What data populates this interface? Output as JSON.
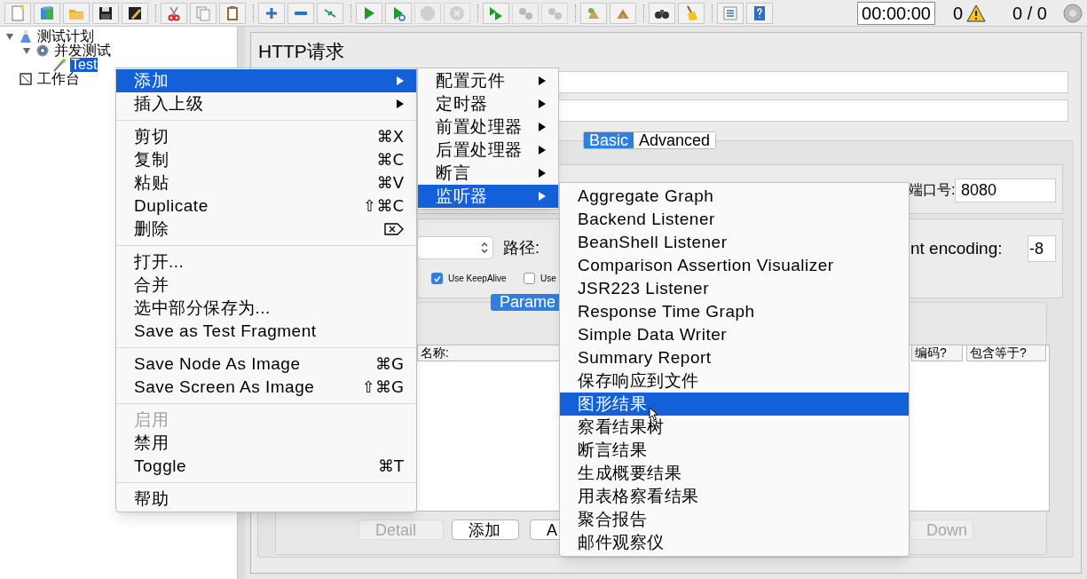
{
  "toolbar": {
    "buttons": [
      {
        "disabled": false
      },
      {
        "disabled": false
      },
      {
        "disabled": false
      },
      {
        "disabled": false
      },
      {
        "disabled": false
      },
      {
        "disabled": false
      },
      {
        "disabled": false
      },
      {
        "disabled": false
      },
      {
        "disabled": false
      },
      {
        "disabled": false
      },
      {
        "disabled": false
      },
      {
        "disabled": false
      },
      {
        "disabled": false
      },
      {
        "disabled": true
      },
      {
        "disabled": true
      },
      {
        "disabled": false
      },
      {
        "disabled": true
      },
      {
        "disabled": true
      },
      {
        "disabled": false
      },
      {
        "disabled": false
      },
      {
        "disabled": false
      },
      {
        "disabled": false
      },
      {
        "disabled": false
      },
      {
        "disabled": false
      }
    ],
    "timer": "00:00:00",
    "warning_count": "0",
    "threads": "0 / 0"
  },
  "tree": [
    {
      "label": "测试计划",
      "kind": "plan",
      "expanded": true,
      "selected": false,
      "children": [
        {
          "label": "并发测试",
          "kind": "thread_group",
          "expanded": true,
          "selected": false,
          "children": [
            {
              "label": "Test",
              "kind": "sampler",
              "selected": true
            }
          ]
        }
      ]
    },
    {
      "label": "工作台",
      "kind": "workbench",
      "selected": false
    }
  ],
  "editor": {
    "title": "HTTP请求",
    "tabs": [
      {
        "label": "Basic",
        "selected": true
      },
      {
        "label": "Advanced",
        "selected": false
      }
    ],
    "port_label": "端口号:",
    "port": "8080",
    "path_label": "路径:",
    "encoding_label": "nt encoding:",
    "encoding": "-8",
    "checkboxes": [
      {
        "label": "Use KeepAlive",
        "checked": true
      },
      {
        "label": "Use",
        "checked": false
      }
    ],
    "params_tab": "Parame",
    "table_columns": [
      "名称:",
      "编码?",
      "包含等于?"
    ],
    "buttons": [
      {
        "label": "Detail",
        "disabled": true
      },
      {
        "label": "添加",
        "disabled": false
      },
      {
        "label": "A",
        "disabled": false
      },
      {
        "label": "Down",
        "disabled": true
      }
    ]
  },
  "context_menu": {
    "sections": [
      [
        {
          "label": "添加",
          "submenu": true,
          "selected": true,
          "disabled": false
        },
        {
          "label": "插入上级",
          "submenu": true,
          "selected": false,
          "disabled": false
        }
      ],
      [
        {
          "label": "剪切",
          "shortcut": "⌘X",
          "selected": false,
          "disabled": false
        },
        {
          "label": "复制",
          "shortcut": "⌘C",
          "selected": false,
          "disabled": false
        },
        {
          "label": "粘贴",
          "shortcut": "⌘V",
          "selected": false,
          "disabled": false
        },
        {
          "label": "Duplicate",
          "shortcut": "⇧⌘C",
          "selected": false,
          "disabled": false
        },
        {
          "label": "删除",
          "delete_key": true,
          "selected": false,
          "disabled": false
        }
      ],
      [
        {
          "label": "打开...",
          "selected": false,
          "disabled": false
        },
        {
          "label": "合并",
          "selected": false,
          "disabled": false
        },
        {
          "label": "选中部分保存为...",
          "selected": false,
          "disabled": false
        },
        {
          "label": "Save as Test Fragment",
          "selected": false,
          "disabled": false
        }
      ],
      [
        {
          "label": "Save Node As Image",
          "shortcut": "⌘G",
          "selected": false,
          "disabled": false
        },
        {
          "label": "Save Screen As Image",
          "shortcut": "⇧⌘G",
          "selected": false,
          "disabled": false
        }
      ],
      [
        {
          "label": "启用",
          "selected": false,
          "disabled": true
        },
        {
          "label": "禁用",
          "selected": false,
          "disabled": false
        },
        {
          "label": "Toggle",
          "shortcut": "⌘T",
          "selected": false,
          "disabled": false
        }
      ],
      [
        {
          "label": "帮助",
          "selected": false,
          "disabled": false
        }
      ]
    ]
  },
  "add_submenu": {
    "items": [
      {
        "label": "配置元件",
        "submenu": true,
        "selected": false
      },
      {
        "label": "定时器",
        "submenu": true,
        "selected": false
      },
      {
        "label": "前置处理器",
        "submenu": true,
        "selected": false
      },
      {
        "label": "后置处理器",
        "submenu": true,
        "selected": false
      },
      {
        "label": "断言",
        "submenu": true,
        "selected": false
      },
      {
        "label": "监听器",
        "submenu": true,
        "selected": true
      }
    ]
  },
  "listener_submenu": {
    "items": [
      {
        "label": "Aggregate Graph",
        "selected": false
      },
      {
        "label": "Backend Listener",
        "selected": false
      },
      {
        "label": "BeanShell Listener",
        "selected": false
      },
      {
        "label": "Comparison Assertion Visualizer",
        "selected": false
      },
      {
        "label": "JSR223 Listener",
        "selected": false
      },
      {
        "label": "Response Time Graph",
        "selected": false
      },
      {
        "label": "Simple Data Writer",
        "selected": false
      },
      {
        "label": "Summary Report",
        "selected": false
      },
      {
        "label": "保存响应到文件",
        "selected": false
      },
      {
        "label": "图形结果",
        "selected": true
      },
      {
        "label": "察看结果树",
        "selected": false
      },
      {
        "label": "断言结果",
        "selected": false
      },
      {
        "label": "生成概要结果",
        "selected": false
      },
      {
        "label": "用表格察看结果",
        "selected": false
      },
      {
        "label": "聚合报告",
        "selected": false
      },
      {
        "label": "邮件观察仪",
        "selected": false
      }
    ]
  }
}
